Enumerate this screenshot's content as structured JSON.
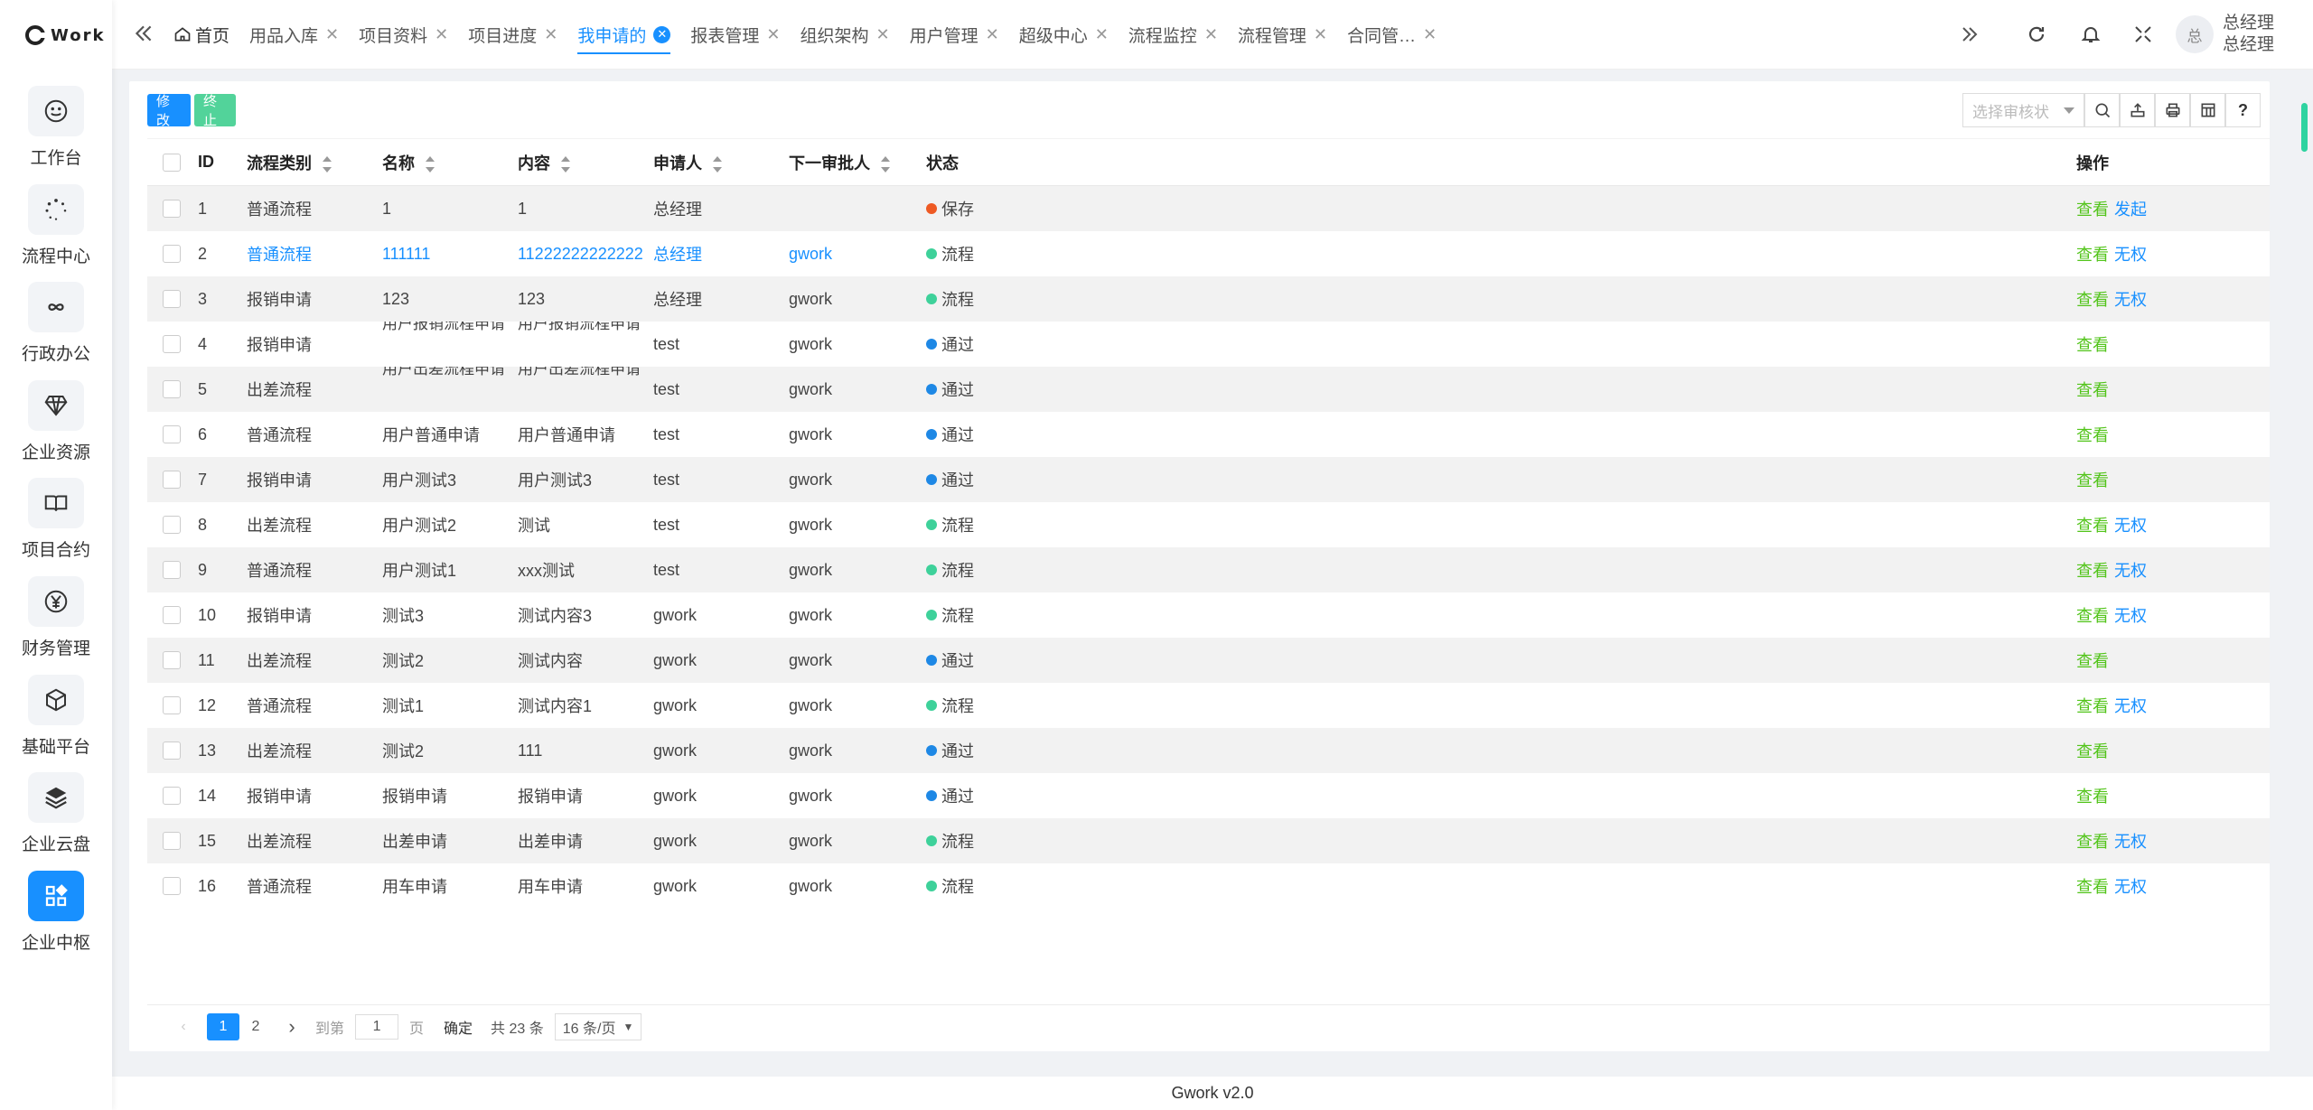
{
  "app": {
    "logo_text": "Work",
    "version": "Gwork v2.0"
  },
  "sidebar": {
    "items": [
      {
        "label": "工作台",
        "icon": "smile-icon"
      },
      {
        "label": "流程中心",
        "icon": "loading-icon"
      },
      {
        "label": "行政办公",
        "icon": "infinity-icon"
      },
      {
        "label": "企业资源",
        "icon": "diamond-icon"
      },
      {
        "label": "项目合约",
        "icon": "book-icon"
      },
      {
        "label": "财务管理",
        "icon": "yen-icon"
      },
      {
        "label": "基础平台",
        "icon": "cube-icon"
      },
      {
        "label": "企业云盘",
        "icon": "layers-icon"
      },
      {
        "label": "企业中枢",
        "icon": "apps-icon",
        "active": true
      }
    ]
  },
  "tabs": [
    {
      "label": "首页",
      "home": true
    },
    {
      "label": "用品入库"
    },
    {
      "label": "项目资料"
    },
    {
      "label": "项目进度"
    },
    {
      "label": "我申请的",
      "active": true
    },
    {
      "label": "报表管理"
    },
    {
      "label": "组织架构"
    },
    {
      "label": "用户管理"
    },
    {
      "label": "超级中心"
    },
    {
      "label": "流程监控"
    },
    {
      "label": "流程管理"
    },
    {
      "label": "合同管…"
    }
  ],
  "user": {
    "avatar": "总",
    "name": "总经理",
    "role": "总经理"
  },
  "toolbar": {
    "edit": "修改",
    "stop": "终止",
    "filter_placeholder": "选择审核状",
    "help": "?"
  },
  "table": {
    "columns": {
      "id": "ID",
      "type": "流程类别",
      "name": "名称",
      "content": "内容",
      "applicant": "申请人",
      "next": "下一审批人",
      "status": "状态",
      "ops": "操作"
    },
    "rows": [
      {
        "id": "1",
        "type": "普通流程",
        "name": "1",
        "content": "1",
        "applicant": "总经理",
        "next": "",
        "status": "保存",
        "status_color": "#ee5a24",
        "ops": [
          "查看",
          "发起"
        ]
      },
      {
        "id": "2",
        "type": "普通流程",
        "name": "111111",
        "content": "11222222222222",
        "applicant": "总经理",
        "next": "gwork",
        "status": "流程",
        "status_color": "#3ed19a",
        "ops": [
          "查看",
          "无权"
        ]
      },
      {
        "id": "3",
        "type": "报销申请",
        "name": "123",
        "content": "123",
        "applicant": "总经理",
        "next": "gwork",
        "status": "流程",
        "status_color": "#3ed19a",
        "ops": [
          "查看",
          "无权"
        ]
      },
      {
        "id": "4",
        "type": "报销申请",
        "name": "用户报销流程申请",
        "content": "用户报销流程申请",
        "applicant": "test",
        "next": "gwork",
        "status": "通过",
        "status_color": "#1e88e5",
        "ops": [
          "查看"
        ]
      },
      {
        "id": "5",
        "type": "出差流程",
        "name": "用户出差流程申请",
        "content": "用户出差流程申请",
        "applicant": "test",
        "next": "gwork",
        "status": "通过",
        "status_color": "#1e88e5",
        "ops": [
          "查看"
        ]
      },
      {
        "id": "6",
        "type": "普通流程",
        "name": "用户普通申请",
        "content": "用户普通申请",
        "applicant": "test",
        "next": "gwork",
        "status": "通过",
        "status_color": "#1e88e5",
        "ops": [
          "查看"
        ]
      },
      {
        "id": "7",
        "type": "报销申请",
        "name": "用户测试3",
        "content": "用户测试3",
        "applicant": "test",
        "next": "gwork",
        "status": "通过",
        "status_color": "#1e88e5",
        "ops": [
          "查看"
        ]
      },
      {
        "id": "8",
        "type": "出差流程",
        "name": "用户测试2",
        "content": "测试",
        "applicant": "test",
        "next": "gwork",
        "status": "流程",
        "status_color": "#3ed19a",
        "ops": [
          "查看",
          "无权"
        ]
      },
      {
        "id": "9",
        "type": "普通流程",
        "name": "用户测试1",
        "content": "xxx测试",
        "applicant": "test",
        "next": "gwork",
        "status": "流程",
        "status_color": "#3ed19a",
        "ops": [
          "查看",
          "无权"
        ]
      },
      {
        "id": "10",
        "type": "报销申请",
        "name": "测试3",
        "content": "测试内容3",
        "applicant": "gwork",
        "next": "gwork",
        "status": "流程",
        "status_color": "#3ed19a",
        "ops": [
          "查看",
          "无权"
        ]
      },
      {
        "id": "11",
        "type": "出差流程",
        "name": "测试2",
        "content": "测试内容",
        "applicant": "gwork",
        "next": "gwork",
        "status": "通过",
        "status_color": "#1e88e5",
        "ops": [
          "查看"
        ]
      },
      {
        "id": "12",
        "type": "普通流程",
        "name": "测试1",
        "content": "测试内容1",
        "applicant": "gwork",
        "next": "gwork",
        "status": "流程",
        "status_color": "#3ed19a",
        "ops": [
          "查看",
          "无权"
        ]
      },
      {
        "id": "13",
        "type": "出差流程",
        "name": "测试2",
        "content": "111",
        "applicant": "gwork",
        "next": "gwork",
        "status": "通过",
        "status_color": "#1e88e5",
        "ops": [
          "查看"
        ]
      },
      {
        "id": "14",
        "type": "报销申请",
        "name": "报销申请",
        "content": "报销申请",
        "applicant": "gwork",
        "next": "gwork",
        "status": "通过",
        "status_color": "#1e88e5",
        "ops": [
          "查看"
        ]
      },
      {
        "id": "15",
        "type": "出差流程",
        "name": "出差申请",
        "content": "出差申请",
        "applicant": "gwork",
        "next": "gwork",
        "status": "流程",
        "status_color": "#3ed19a",
        "ops": [
          "查看",
          "无权"
        ]
      },
      {
        "id": "16",
        "type": "普通流程",
        "name": "用车申请",
        "content": "用车申请",
        "applicant": "gwork",
        "next": "gwork",
        "status": "流程",
        "status_color": "#3ed19a",
        "ops": [
          "查看",
          "无权"
        ]
      }
    ]
  },
  "pagination": {
    "pages": [
      "1",
      "2"
    ],
    "current": "1",
    "goto_label": "到第",
    "goto_value": "1",
    "page_unit": "页",
    "confirm": "确定",
    "total": "共 23 条",
    "page_size": "16 条/页"
  }
}
